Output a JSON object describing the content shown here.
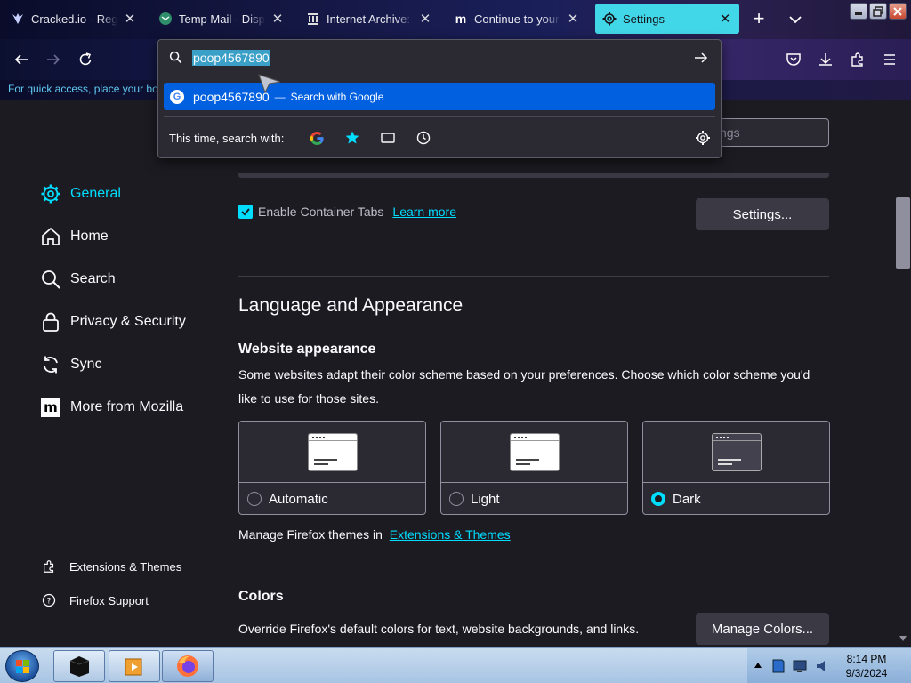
{
  "tabs": [
    {
      "title": "Cracked.io - Registra",
      "favicon": "cracked-logo-icon"
    },
    {
      "title": "Temp Mail - Disposa",
      "favicon": "tempmail-icon"
    },
    {
      "title": "Internet Archive: Dig",
      "favicon": "archive-building-icon"
    },
    {
      "title": "Continue to your Mi",
      "favicon": "m-logo-icon"
    },
    {
      "title": "Settings",
      "favicon": "gear-icon",
      "active": true
    }
  ],
  "toolbar": {
    "bookmarks_hint": "For quick access, place your boo"
  },
  "urlbar": {
    "value": "poop4567890",
    "suggestion_term": "poop4567890",
    "suggestion_separator": "—",
    "suggestion_action": "Search with Google",
    "search_with_label": "This time, search with:"
  },
  "settings": {
    "find_placeholder": "ngs",
    "nav": [
      {
        "label": "General",
        "icon": "gear-icon",
        "active": true
      },
      {
        "label": "Home",
        "icon": "home-icon"
      },
      {
        "label": "Search",
        "icon": "search-icon"
      },
      {
        "label": "Privacy & Security",
        "icon": "lock-icon"
      },
      {
        "label": "Sync",
        "icon": "sync-icon"
      },
      {
        "label": "More from Mozilla",
        "icon": "mozilla-m-icon"
      }
    ],
    "footer": [
      {
        "label": "Extensions & Themes",
        "icon": "puzzle-icon"
      },
      {
        "label": "Firefox Support",
        "icon": "help-icon"
      }
    ],
    "container_tabs_label": "Enable Container Tabs",
    "learn_more": "Learn more",
    "settings_button": "Settings...",
    "lang_section_title": "Language and Appearance",
    "website_appearance_title": "Website appearance",
    "website_appearance_desc": "Some websites adapt their color scheme based on your preferences. Choose which color scheme you'd like to use for those sites.",
    "schemes": [
      {
        "label": "Automatic",
        "selected": false
      },
      {
        "label": "Light",
        "selected": false
      },
      {
        "label": "Dark",
        "selected": true
      }
    ],
    "manage_themes_text": "Manage Firefox themes in",
    "manage_themes_link": "Extensions & Themes",
    "colors_title": "Colors",
    "colors_desc": "Override Firefox's default colors for text, website backgrounds, and links.",
    "manage_colors_button": "Manage Colors..."
  },
  "taskbar": {
    "time": "8:14 PM",
    "date": "9/3/2024"
  },
  "colors": {
    "accent": "#00ddff",
    "active_tab": "#42d7e8",
    "highlight": "#0060df",
    "page_bg": "#1c1b22"
  }
}
